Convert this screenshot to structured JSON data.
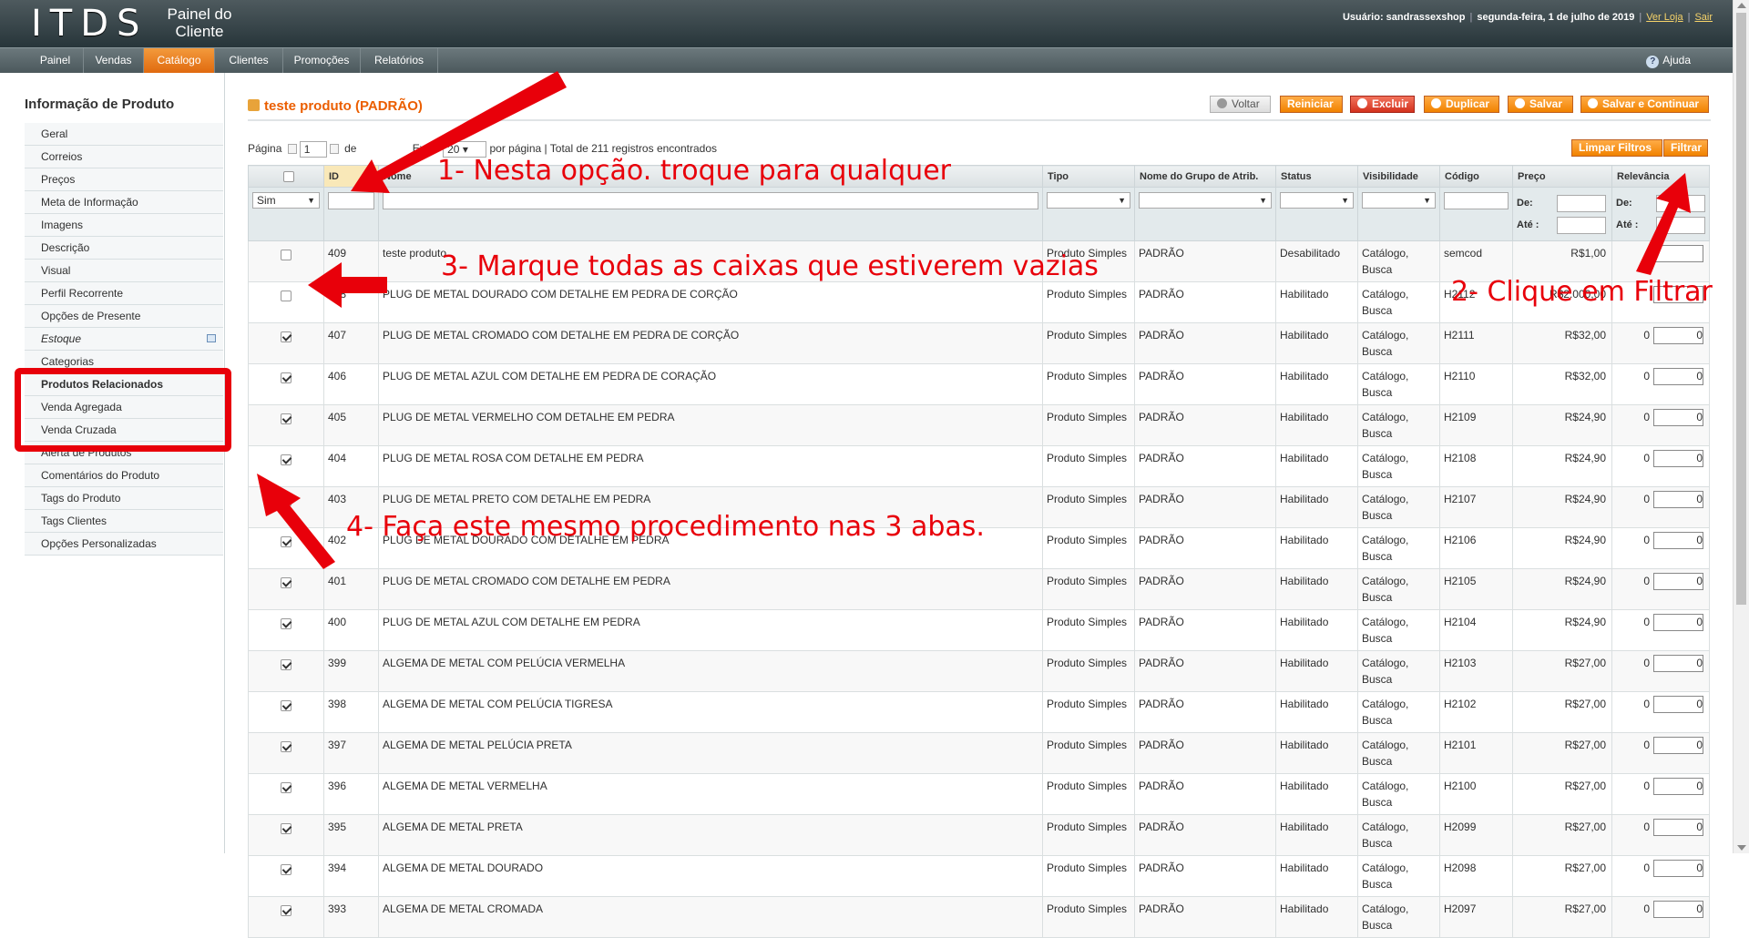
{
  "header": {
    "logo": "ITDS",
    "logo_sub": "Painel do Cliente",
    "user": "Usuário: sandrassexshop",
    "date": "segunda-feira, 1 de julho de 2019",
    "view_store": "Ver Loja",
    "logout": "Sair"
  },
  "nav": {
    "items": [
      "Painel",
      "Vendas",
      "Catálogo",
      "Clientes",
      "Promoções",
      "Relatórios"
    ],
    "active": "Catálogo",
    "help": "Ajuda"
  },
  "sidebar": {
    "title": "Informação de Produto",
    "items": [
      "Geral",
      "Correios",
      "Preços",
      "Meta de Informação",
      "Imagens",
      "Descrição",
      "Visual",
      "Perfil Recorrente",
      "Opções de Presente",
      "Estoque",
      "Categorias",
      "Produtos Relacionados",
      "Venda Agregada",
      "Venda Cruzada",
      "Alerta de Produtos",
      "Comentários do Produto",
      "Tags do Produto",
      "Tags Clientes",
      "Opções Personalizadas"
    ]
  },
  "page": {
    "title": "teste produto (PADRÃO)",
    "buttons": {
      "back": "Voltar",
      "reset": "Reiniciar",
      "delete": "Excluir",
      "duplicate": "Duplicar",
      "save": "Salvar",
      "save_continue": "Salvar e Continuar"
    }
  },
  "pager": {
    "page_label": "Página",
    "page_value": "1",
    "of_label": "de",
    "show_label": "Exibir",
    "per_page": "20",
    "per_page_label": "por página",
    "total": "Total de 211 registros encontrados",
    "clear_filters": "Limpar Filtros",
    "filter": "Filtrar"
  },
  "grid": {
    "columns": [
      "",
      "ID",
      "Nome",
      "Tipo",
      "Nome do Grupo de Atrib.",
      "Status",
      "Visibilidade",
      "Código",
      "Preço",
      "Relevância"
    ],
    "filter": {
      "checkbox_select": "Sim",
      "from_label": "De:",
      "to_label": "Até :"
    },
    "rows": [
      {
        "checked": false,
        "id": "409",
        "name": "teste produto",
        "type": "Produto Simples",
        "set": "PADRÃO",
        "status": "Desabilitado",
        "vis": "Catálogo, Busca",
        "sku": "semcod",
        "price": "R$1,00",
        "pos": "",
        "posin": ""
      },
      {
        "checked": false,
        "id": "408",
        "name": "PLUG DE METAL DOURADO COM DETALHE EM PEDRA DE CORÇÃO",
        "type": "Produto Simples",
        "set": "PADRÃO",
        "status": "Habilitado",
        "vis": "Catálogo, Busca",
        "sku": "H2112",
        "price": "R$2.000,00",
        "pos": "",
        "posin": ""
      },
      {
        "checked": true,
        "id": "407",
        "name": "PLUG DE METAL CROMADO COM DETALHE EM PEDRA DE CORÇÃO",
        "type": "Produto Simples",
        "set": "PADRÃO",
        "status": "Habilitado",
        "vis": "Catálogo, Busca",
        "sku": "H2111",
        "price": "R$32,00",
        "pos": "0",
        "posin": "0"
      },
      {
        "checked": true,
        "id": "406",
        "name": "PLUG DE METAL AZUL COM DETALHE EM PEDRA DE CORAÇÃO",
        "type": "Produto Simples",
        "set": "PADRÃO",
        "status": "Habilitado",
        "vis": "Catálogo, Busca",
        "sku": "H2110",
        "price": "R$32,00",
        "pos": "0",
        "posin": "0"
      },
      {
        "checked": true,
        "id": "405",
        "name": "PLUG DE METAL VERMELHO COM DETALHE EM PEDRA",
        "type": "Produto Simples",
        "set": "PADRÃO",
        "status": "Habilitado",
        "vis": "Catálogo, Busca",
        "sku": "H2109",
        "price": "R$24,90",
        "pos": "0",
        "posin": "0"
      },
      {
        "checked": true,
        "id": "404",
        "name": "PLUG DE METAL ROSA COM DETALHE EM PEDRA",
        "type": "Produto Simples",
        "set": "PADRÃO",
        "status": "Habilitado",
        "vis": "Catálogo, Busca",
        "sku": "H2108",
        "price": "R$24,90",
        "pos": "0",
        "posin": "0"
      },
      {
        "checked": true,
        "id": "403",
        "name": "PLUG DE METAL PRETO COM DETALHE EM PEDRA",
        "type": "Produto Simples",
        "set": "PADRÃO",
        "status": "Habilitado",
        "vis": "Catálogo, Busca",
        "sku": "H2107",
        "price": "R$24,90",
        "pos": "0",
        "posin": "0"
      },
      {
        "checked": true,
        "id": "402",
        "name": "PLUG DE METAL DOURADO COM DETALHE EM PEDRA",
        "type": "Produto Simples",
        "set": "PADRÃO",
        "status": "Habilitado",
        "vis": "Catálogo, Busca",
        "sku": "H2106",
        "price": "R$24,90",
        "pos": "0",
        "posin": "0"
      },
      {
        "checked": true,
        "id": "401",
        "name": "PLUG DE METAL CROMADO COM DETALHE EM PEDRA",
        "type": "Produto Simples",
        "set": "PADRÃO",
        "status": "Habilitado",
        "vis": "Catálogo, Busca",
        "sku": "H2105",
        "price": "R$24,90",
        "pos": "0",
        "posin": "0"
      },
      {
        "checked": true,
        "id": "400",
        "name": "PLUG DE METAL AZUL COM DETALHE EM PEDRA",
        "type": "Produto Simples",
        "set": "PADRÃO",
        "status": "Habilitado",
        "vis": "Catálogo, Busca",
        "sku": "H2104",
        "price": "R$24,90",
        "pos": "0",
        "posin": "0"
      },
      {
        "checked": true,
        "id": "399",
        "name": "ALGEMA DE METAL COM PELÚCIA VERMELHA",
        "type": "Produto Simples",
        "set": "PADRÃO",
        "status": "Habilitado",
        "vis": "Catálogo, Busca",
        "sku": "H2103",
        "price": "R$27,00",
        "pos": "0",
        "posin": "0"
      },
      {
        "checked": true,
        "id": "398",
        "name": "ALGEMA DE METAL COM PELÚCIA TIGRESA",
        "type": "Produto Simples",
        "set": "PADRÃO",
        "status": "Habilitado",
        "vis": "Catálogo, Busca",
        "sku": "H2102",
        "price": "R$27,00",
        "pos": "0",
        "posin": "0"
      },
      {
        "checked": true,
        "id": "397",
        "name": "ALGEMA DE METAL PELÚCIA PRETA",
        "type": "Produto Simples",
        "set": "PADRÃO",
        "status": "Habilitado",
        "vis": "Catálogo, Busca",
        "sku": "H2101",
        "price": "R$27,00",
        "pos": "0",
        "posin": "0"
      },
      {
        "checked": true,
        "id": "396",
        "name": "ALGEMA DE METAL VERMELHA",
        "type": "Produto Simples",
        "set": "PADRÃO",
        "status": "Habilitado",
        "vis": "Catálogo, Busca",
        "sku": "H2100",
        "price": "R$27,00",
        "pos": "0",
        "posin": "0"
      },
      {
        "checked": true,
        "id": "395",
        "name": "ALGEMA DE METAL PRETA",
        "type": "Produto Simples",
        "set": "PADRÃO",
        "status": "Habilitado",
        "vis": "Catálogo, Busca",
        "sku": "H2099",
        "price": "R$27,00",
        "pos": "0",
        "posin": "0"
      },
      {
        "checked": true,
        "id": "394",
        "name": "ALGEMA DE METAL DOURADO",
        "type": "Produto Simples",
        "set": "PADRÃO",
        "status": "Habilitado",
        "vis": "Catálogo, Busca",
        "sku": "H2098",
        "price": "R$27,00",
        "pos": "0",
        "posin": "0"
      },
      {
        "checked": true,
        "id": "393",
        "name": "ALGEMA DE METAL CROMADA",
        "type": "Produto Simples",
        "set": "PADRÃO",
        "status": "Habilitado",
        "vis": "Catálogo, Busca",
        "sku": "H2097",
        "price": "R$27,00",
        "pos": "0",
        "posin": "0"
      }
    ]
  },
  "annotations": {
    "step1": "1- Nesta opção. troque para qualquer",
    "step2": "2- Clique em Filtrar",
    "step3": "3- Marque todas as caixas que estiverem vazias",
    "step4": "4- Faça este mesmo procedimento nas 3 abas."
  },
  "colors": {
    "accent": "#eb5e00",
    "annotation": "#e8000a",
    "nav_active": "#f18200"
  }
}
